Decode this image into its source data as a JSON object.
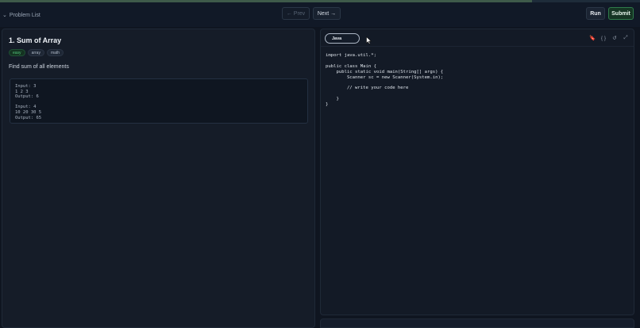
{
  "header": {
    "problem_list_label": "Problem List",
    "prev_label": "← Prev",
    "next_label": "Next →",
    "run_label": "Run",
    "submit_label": "Submit"
  },
  "problem": {
    "title": "1. Sum of Array",
    "tags": [
      {
        "label": "easy",
        "color": "#52c27b"
      },
      {
        "label": "array"
      },
      {
        "label": "math"
      }
    ],
    "description": "Find sum of all elements",
    "examples": [
      {
        "lines": [
          "Input: 3",
          "1 2 3",
          "Output: 6"
        ]
      },
      {
        "lines": [
          "Input: 4",
          "10 20 30 5",
          "Output: 65"
        ]
      }
    ]
  },
  "editor": {
    "language": "Java",
    "icons": [
      "bookmark-icon",
      "braces-icon",
      "reset-icon",
      "expand-icon"
    ],
    "code_lines": [
      "import java.util.*;",
      "",
      "public class Main {",
      "    public static void main(String[] args) {",
      "        Scanner sc = new Scanner(System.in);",
      "",
      "        // write your code here",
      "",
      "    }",
      "}"
    ]
  },
  "colors": {
    "accent_green": "#2f7a4a",
    "background": "#0f1520",
    "panel": "#151c28"
  }
}
